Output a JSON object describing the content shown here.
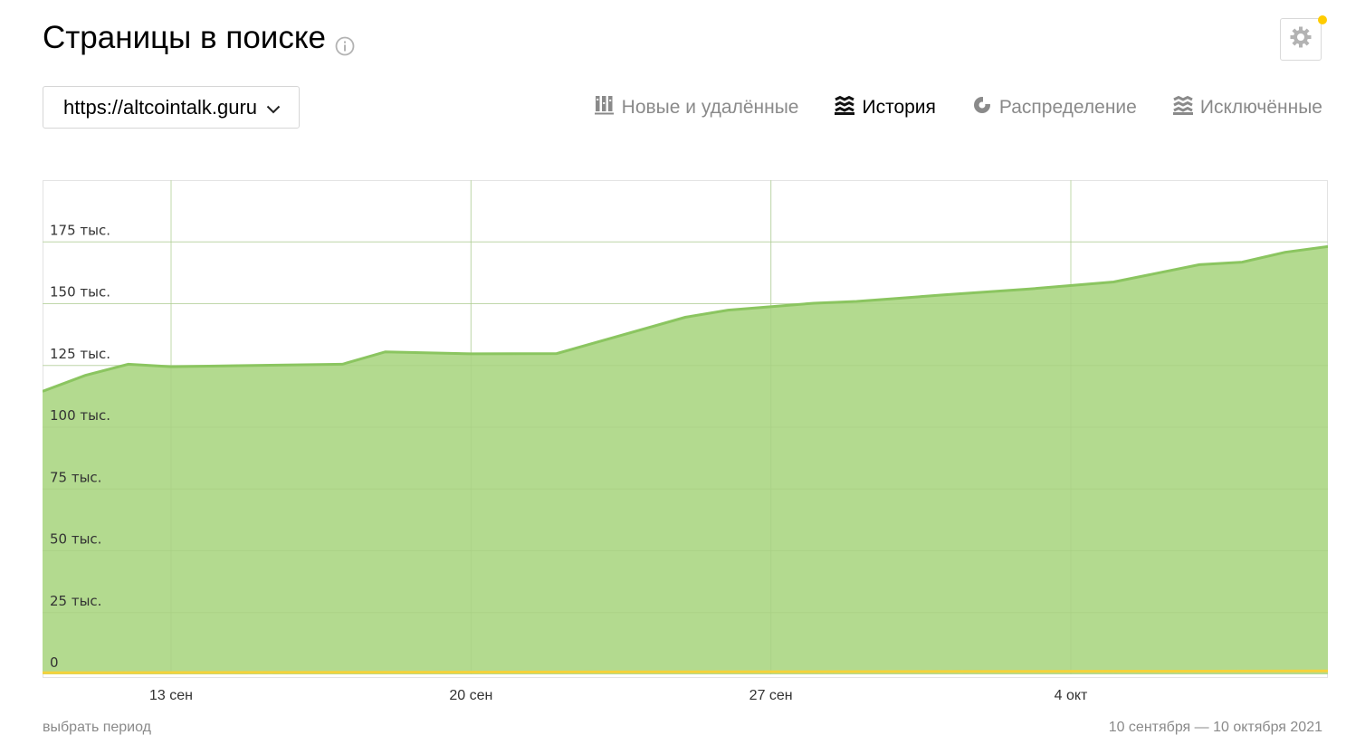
{
  "header": {
    "title": "Страницы в поиске"
  },
  "host_select": {
    "value": "https://altcointalk.guru"
  },
  "tabs": [
    {
      "label": "Новые и удалённые",
      "icon": "bars-icon",
      "active": false
    },
    {
      "label": "История",
      "icon": "layers-icon",
      "active": true
    },
    {
      "label": "Распределение",
      "icon": "pie-icon",
      "active": false
    },
    {
      "label": "Исключённые",
      "icon": "layers-icon",
      "active": false
    }
  ],
  "footer": {
    "period_link": "выбрать период",
    "date_range": "10 сентября — 10 октября 2021"
  },
  "colors": {
    "area_fill": "#b1d98d",
    "area_line": "#8bc560",
    "baseline": "#f5d23b",
    "grid": "#e6e6e6",
    "notification_dot": "#ffcc00"
  },
  "chart_data": {
    "type": "area",
    "title": "",
    "xlabel": "",
    "ylabel": "",
    "ylim": [
      0,
      200000
    ],
    "xlim": [
      "2021-09-10",
      "2021-10-10"
    ],
    "x_ticks": [
      {
        "date": "2021-09-13",
        "label": "13 сен"
      },
      {
        "date": "2021-09-20",
        "label": "20 сен"
      },
      {
        "date": "2021-09-27",
        "label": "27 сен"
      },
      {
        "date": "2021-10-04",
        "label": "4 окт"
      }
    ],
    "y_ticks": [
      {
        "value": 0,
        "label": "0"
      },
      {
        "value": 25000,
        "label": "25 тыс."
      },
      {
        "value": 50000,
        "label": "50 тыс."
      },
      {
        "value": 75000,
        "label": "75 тыс."
      },
      {
        "value": 100000,
        "label": "100 тыс."
      },
      {
        "value": 125000,
        "label": "125 тыс."
      },
      {
        "value": 150000,
        "label": "150 тыс."
      },
      {
        "value": 175000,
        "label": "175 тыс."
      }
    ],
    "grid": true,
    "series": [
      {
        "color": "#8bc560",
        "x": [
          "2021-09-10",
          "2021-09-11",
          "2021-09-12",
          "2021-09-13",
          "2021-09-17",
          "2021-09-18",
          "2021-09-20",
          "2021-09-22",
          "2021-09-25",
          "2021-09-26",
          "2021-09-28",
          "2021-09-29",
          "2021-10-01",
          "2021-10-03",
          "2021-10-05",
          "2021-10-07",
          "2021-10-08",
          "2021-10-09",
          "2021-10-10"
        ],
        "values": [
          114500,
          121000,
          125500,
          124500,
          125500,
          130500,
          129700,
          129800,
          144500,
          147400,
          150200,
          150900,
          153500,
          155900,
          158800,
          165800,
          166800,
          170800,
          173100
        ]
      },
      {
        "color": "#f5d23b",
        "x": [
          "2021-09-10",
          "2021-10-10"
        ],
        "values": [
          300,
          1000
        ]
      }
    ]
  }
}
